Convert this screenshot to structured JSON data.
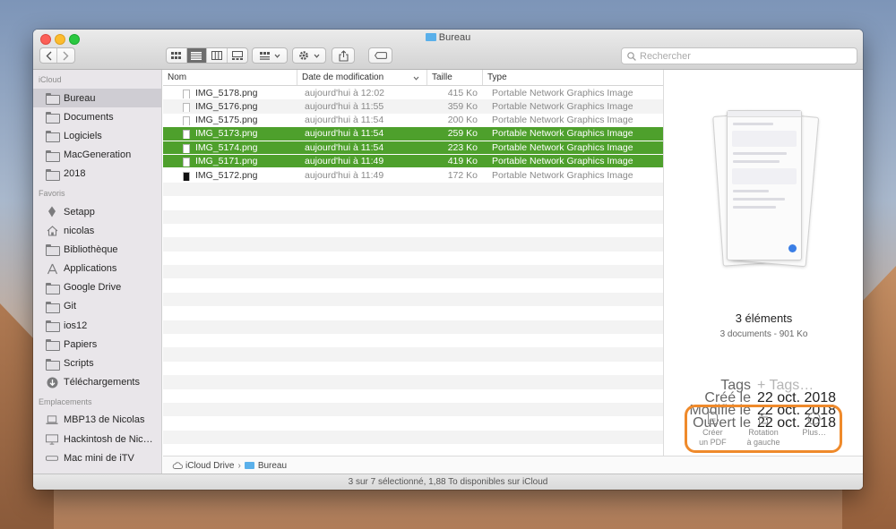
{
  "window": {
    "title": "Bureau"
  },
  "toolbar": {
    "search_placeholder": "Rechercher"
  },
  "sidebar": {
    "sections": [
      {
        "header": "iCloud",
        "items": [
          {
            "label": "Bureau",
            "icon": "folder-icon",
            "selected": true
          },
          {
            "label": "Documents",
            "icon": "folder-icon"
          },
          {
            "label": "Logiciels",
            "icon": "folder-icon"
          },
          {
            "label": "MacGeneration",
            "icon": "folder-icon"
          },
          {
            "label": "2018",
            "icon": "folder-icon"
          }
        ]
      },
      {
        "header": "Favoris",
        "items": [
          {
            "label": "Setapp",
            "icon": "setapp-icon"
          },
          {
            "label": "nicolas",
            "icon": "home-icon"
          },
          {
            "label": "Bibliothèque",
            "icon": "folder-icon"
          },
          {
            "label": "Applications",
            "icon": "applications-icon"
          },
          {
            "label": "Google Drive",
            "icon": "folder-icon"
          },
          {
            "label": "Git",
            "icon": "folder-icon"
          },
          {
            "label": "ios12",
            "icon": "folder-icon"
          },
          {
            "label": "Papiers",
            "icon": "folder-icon"
          },
          {
            "label": "Scripts",
            "icon": "folder-icon"
          },
          {
            "label": "Téléchargements",
            "icon": "download-icon"
          }
        ]
      },
      {
        "header": "Emplacements",
        "items": [
          {
            "label": "MBP13 de Nicolas",
            "icon": "laptop-icon"
          },
          {
            "label": "Hackintosh de Nic…",
            "icon": "display-icon"
          },
          {
            "label": "Mac mini de iTV",
            "icon": "mac-mini-icon"
          }
        ]
      }
    ]
  },
  "columns": {
    "name": "Nom",
    "date": "Date de modification",
    "size": "Taille",
    "type": "Type"
  },
  "files": [
    {
      "name": "IMG_5178.png",
      "date": "aujourd'hui à 12:02",
      "size": "415 Ko",
      "type": "Portable Network Graphics Image",
      "selected": false
    },
    {
      "name": "IMG_5176.png",
      "date": "aujourd'hui à 11:55",
      "size": "359 Ko",
      "type": "Portable Network Graphics Image",
      "selected": false
    },
    {
      "name": "IMG_5175.png",
      "date": "aujourd'hui à 11:54",
      "size": "200 Ko",
      "type": "Portable Network Graphics Image",
      "selected": false
    },
    {
      "name": "IMG_5173.png",
      "date": "aujourd'hui à 11:54",
      "size": "259 Ko",
      "type": "Portable Network Graphics Image",
      "selected": true
    },
    {
      "name": "IMG_5174.png",
      "date": "aujourd'hui à 11:54",
      "size": "223 Ko",
      "type": "Portable Network Graphics Image",
      "selected": true
    },
    {
      "name": "IMG_5171.png",
      "date": "aujourd'hui à 11:49",
      "size": "419 Ko",
      "type": "Portable Network Graphics Image",
      "selected": true
    },
    {
      "name": "IMG_5172.png",
      "date": "aujourd'hui à 11:49",
      "size": "172 Ko",
      "type": "Portable Network Graphics Image",
      "selected": false
    }
  ],
  "pathbar": {
    "root": "iCloud Drive",
    "current": "Bureau"
  },
  "status": "3 sur 7 sélectionné, 1,88 To disponibles sur iCloud",
  "preview": {
    "title": "3 éléments",
    "subtitle": "3 documents - 901 Ko",
    "meta": [
      {
        "key": "Tags",
        "value": "+ Tags…",
        "placeholder": true
      },
      {
        "key": "Créé le",
        "value": "22 oct. 2018"
      },
      {
        "key": "Modifié le",
        "value": "22 oct. 2018"
      },
      {
        "key": "Ouvert le",
        "value": "22 oct. 2018"
      }
    ],
    "actions": [
      {
        "line1": "Créer",
        "line2": "un PDF",
        "icon": "pdf-icon"
      },
      {
        "line1": "Rotation",
        "line2": "à gauche",
        "icon": "rotate-left-icon"
      },
      {
        "line1": "Plus…",
        "line2": "",
        "icon": "more-icon"
      }
    ]
  },
  "colors": {
    "selection": "#4ea02c",
    "highlight_ring": "#ef8a2b",
    "folder_accent": "#5ab0ea"
  }
}
